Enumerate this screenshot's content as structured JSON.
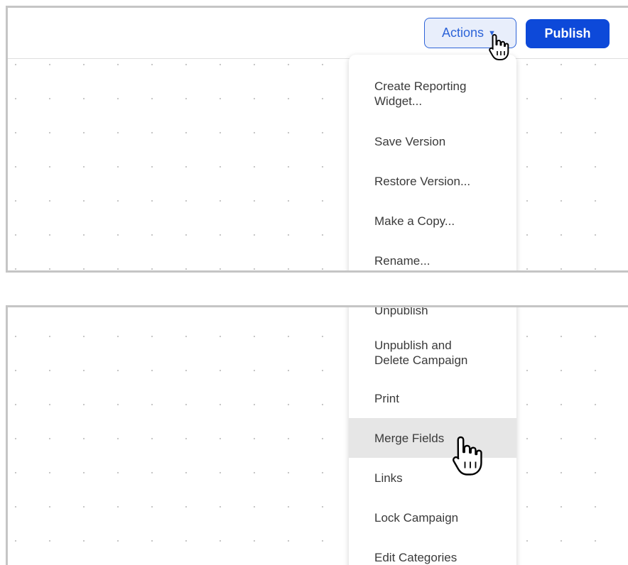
{
  "toolbar": {
    "actions_label": "Actions",
    "publish_label": "Publish"
  },
  "menu_top": [
    "Create Reporting\nWidget...",
    "Save Version",
    "Restore Version...",
    "Make a Copy...",
    "Rename..."
  ],
  "menu_bottom": [
    "Unpublish",
    "Unpublish and\nDelete Campaign",
    "Print",
    "Merge Fields",
    "Links",
    "Lock Campaign",
    "Edit Categories"
  ],
  "hovered_item": "Merge Fields",
  "colors": {
    "accent": "#2d64d8",
    "publish_bg": "#0d49d9",
    "hover_bg": "#e6e6e6"
  },
  "icons": [
    "chevron-down-icon",
    "hand-pointer-icon"
  ]
}
